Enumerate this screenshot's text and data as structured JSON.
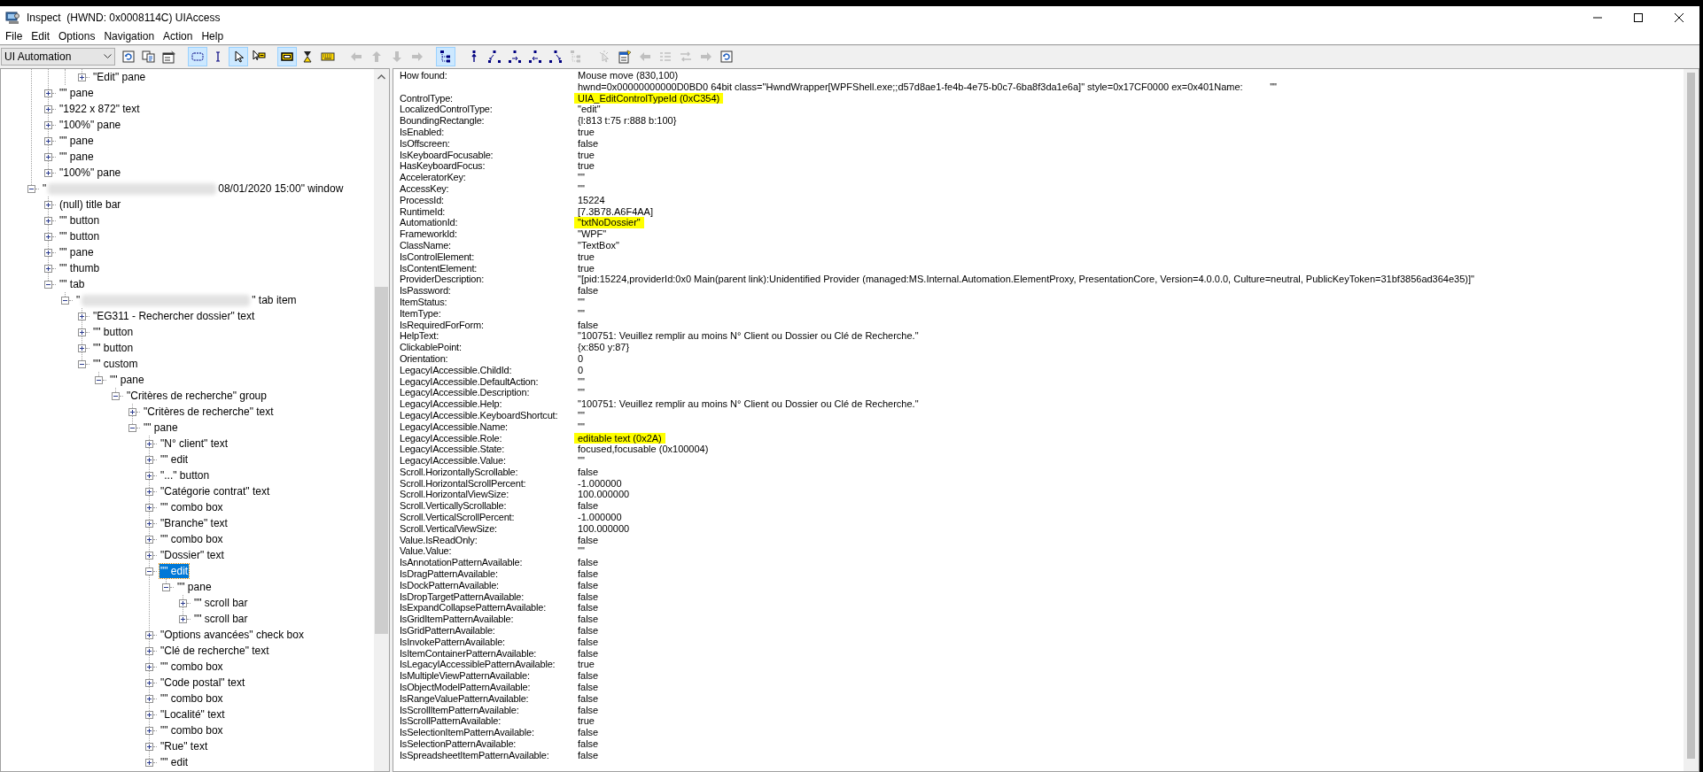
{
  "window": {
    "title": "Inspect  (HWND: 0x0008114C) UIAccess"
  },
  "menu": [
    "File",
    "Edit",
    "Options",
    "Navigation",
    "Action",
    "Help"
  ],
  "toolbar": {
    "mode_combo": {
      "value": "UI Automation"
    },
    "groups": [
      [
        {
          "kind": "refresh",
          "selected": false,
          "disabled": false
        },
        {
          "kind": "copy",
          "selected": false,
          "disabled": false
        },
        {
          "kind": "properties",
          "selected": false,
          "disabled": false
        }
      ],
      [
        {
          "kind": "rect",
          "selected": true,
          "disabled": false
        },
        {
          "kind": "caret",
          "selected": false,
          "disabled": false
        },
        {
          "kind": "pointer",
          "selected": true,
          "disabled": false
        },
        {
          "kind": "hover",
          "selected": false,
          "disabled": false
        }
      ],
      [
        {
          "kind": "highlight",
          "selected": true,
          "disabled": false
        },
        {
          "kind": "hourglass",
          "selected": false,
          "disabled": false
        },
        {
          "kind": "keyboard",
          "selected": false,
          "disabled": false
        }
      ],
      [
        {
          "kind": "left",
          "selected": false,
          "disabled": true
        },
        {
          "kind": "up",
          "selected": false,
          "disabled": true
        },
        {
          "kind": "down",
          "selected": false,
          "disabled": true
        },
        {
          "kind": "right",
          "selected": false,
          "disabled": true
        }
      ],
      [
        {
          "kind": "tree",
          "selected": true,
          "disabled": false
        }
      ],
      [
        {
          "kind": "parent",
          "selected": false,
          "disabled": false
        },
        {
          "kind": "first",
          "selected": false,
          "disabled": false
        },
        {
          "kind": "next",
          "selected": false,
          "disabled": false
        },
        {
          "kind": "prev",
          "selected": false,
          "disabled": false
        },
        {
          "kind": "last",
          "selected": false,
          "disabled": false
        },
        {
          "kind": "tree",
          "selected": false,
          "disabled": true
        }
      ],
      [
        {
          "kind": "click",
          "selected": false,
          "disabled": true
        },
        {
          "kind": "notepad",
          "selected": false,
          "disabled": false
        },
        {
          "kind": "left",
          "selected": false,
          "disabled": true
        },
        {
          "kind": "list",
          "selected": false,
          "disabled": true
        },
        {
          "kind": "swap",
          "selected": false,
          "disabled": true
        },
        {
          "kind": "right",
          "selected": false,
          "disabled": true
        },
        {
          "kind": "refresh",
          "selected": false,
          "disabled": false
        }
      ]
    ]
  },
  "tree": {
    "nodes": [
      {
        "children": [
          {
            "children": [
              {
                "children": [
                  {
                    "label": "\"Edit\" pane",
                    "expanded": false,
                    "selected": false
                  }
                ]
              }
            ]
          },
          {
            "label": "\"\" pane",
            "expanded": false,
            "selected": false
          },
          {
            "label": "\"1922 x 872\" text",
            "expanded": false,
            "selected": false
          },
          {
            "label": "\"100%\" pane",
            "expanded": false,
            "selected": false
          },
          {
            "label": "\"\" pane",
            "expanded": false,
            "selected": false
          },
          {
            "label": "\"\" pane",
            "expanded": false,
            "selected": false
          },
          {
            "label": "\"100%\" pane",
            "expanded": false,
            "selected": false
          }
        ]
      },
      {
        "prefix": "\"",
        "redacted": true,
        "label": "08/01/2020 15:00\" window",
        "expanded": true,
        "selected": false,
        "children": [
          {
            "label": "(null) title bar",
            "expanded": false,
            "selected": false
          },
          {
            "label": "\"\" button",
            "expanded": false,
            "selected": false
          },
          {
            "label": "\"\" button",
            "expanded": false,
            "selected": false
          },
          {
            "label": "\"\" pane",
            "expanded": false,
            "selected": false
          },
          {
            "label": "\"\" thumb",
            "expanded": false,
            "selected": false
          },
          {
            "label": "\"\" tab",
            "expanded": true,
            "selected": false,
            "children": [
              {
                "prefix": "\"",
                "redacted": true,
                "label": "\" tab item",
                "expanded": true,
                "selected": false,
                "children": [
                  {
                    "label": "\"EG311 - Rechercher dossier\" text",
                    "expanded": false,
                    "selected": false
                  },
                  {
                    "label": "\"\" button",
                    "expanded": false,
                    "selected": false
                  },
                  {
                    "label": "\"\" button",
                    "expanded": false,
                    "selected": false
                  },
                  {
                    "label": "\"\" custom",
                    "expanded": true,
                    "selected": false,
                    "children": [
                      {
                        "label": "\"\" pane",
                        "expanded": true,
                        "selected": false,
                        "children": [
                          {
                            "label": "\"Critères de recherche\" group",
                            "expanded": true,
                            "selected": false,
                            "children": [
                              {
                                "label": "\"Critères de recherche\" text",
                                "expanded": false,
                                "selected": false
                              },
                              {
                                "label": "\"\" pane",
                                "expanded": true,
                                "selected": false,
                                "children": [
                                  {
                                    "label": "\"N° client\" text",
                                    "expanded": false,
                                    "selected": false
                                  },
                                  {
                                    "label": "\"\" edit",
                                    "expanded": false,
                                    "selected": false
                                  },
                                  {
                                    "label": "\"...\" button",
                                    "expanded": false,
                                    "selected": false
                                  },
                                  {
                                    "label": "\"Catégorie contrat\" text",
                                    "expanded": false,
                                    "selected": false
                                  },
                                  {
                                    "label": "\"\" combo box",
                                    "expanded": false,
                                    "selected": false
                                  },
                                  {
                                    "label": "\"Branche\" text",
                                    "expanded": false,
                                    "selected": false
                                  },
                                  {
                                    "label": "\"\" combo box",
                                    "expanded": false,
                                    "selected": false
                                  },
                                  {
                                    "label": "\"Dossier\" text",
                                    "expanded": false,
                                    "selected": false
                                  },
                                  {
                                    "label": "\"\" edit",
                                    "expanded": true,
                                    "selected": true,
                                    "children": [
                                      {
                                        "label": "\"\" pane",
                                        "expanded": true,
                                        "selected": false,
                                        "children": [
                                          {
                                            "label": "\"\" scroll bar",
                                            "expanded": false,
                                            "selected": false
                                          },
                                          {
                                            "label": "\"\" scroll bar",
                                            "expanded": false,
                                            "selected": false
                                          }
                                        ]
                                      }
                                    ]
                                  },
                                  {
                                    "label": "\"Options avancées\" check box",
                                    "expanded": false,
                                    "selected": false
                                  },
                                  {
                                    "label": "\"Clé de recherche\" text",
                                    "expanded": false,
                                    "selected": false
                                  },
                                  {
                                    "label": "\"\" combo box",
                                    "expanded": false,
                                    "selected": false
                                  },
                                  {
                                    "label": "\"Code postal\" text",
                                    "expanded": false,
                                    "selected": false
                                  },
                                  {
                                    "label": "\"\" combo box",
                                    "expanded": false,
                                    "selected": false
                                  },
                                  {
                                    "label": "\"Localité\" text",
                                    "expanded": false,
                                    "selected": false
                                  },
                                  {
                                    "label": "\"\" combo box",
                                    "expanded": false,
                                    "selected": false
                                  },
                                  {
                                    "label": "\"Rue\" text",
                                    "expanded": false,
                                    "selected": false
                                  },
                                  {
                                    "label": "\"\" edit",
                                    "expanded": false,
                                    "selected": false
                                  }
                                ]
                              }
                            ]
                          }
                        ]
                      }
                    ]
                  }
                ]
              }
            ]
          }
        ]
      }
    ]
  },
  "properties": [
    {
      "name": "How found:",
      "value": "Mouse move (830,100)\nhwnd=0x00000000000D0BD0 64bit class=\"HwndWrapper[WPFShell.exe;;d57d8ae1-fe4b-4e75-b0c7-6ba8f3da1e6a]\" style=0x17CF0000 ex=0x401Name:          \"\"",
      "highlighted": false
    },
    {
      "name": "ControlType:",
      "value": "UIA_EditControlTypeId (0xC354)",
      "highlighted": true
    },
    {
      "name": "LocalizedControlType:",
      "value": "\"edit\"",
      "highlighted": false
    },
    {
      "name": "BoundingRectangle:",
      "value": "{l:813 t:75 r:888 b:100}",
      "highlighted": false
    },
    {
      "name": "IsEnabled:",
      "value": "true",
      "highlighted": false
    },
    {
      "name": "IsOffscreen:",
      "value": "false",
      "highlighted": false
    },
    {
      "name": "IsKeyboardFocusable:",
      "value": "true",
      "highlighted": false
    },
    {
      "name": "HasKeyboardFocus:",
      "value": "true",
      "highlighted": false
    },
    {
      "name": "AcceleratorKey:",
      "value": "\"\"",
      "highlighted": false
    },
    {
      "name": "AccessKey:",
      "value": "\"\"",
      "highlighted": false
    },
    {
      "name": "ProcessId:",
      "value": "15224",
      "highlighted": false
    },
    {
      "name": "RuntimeId:",
      "value": "[7.3B78.A6F4AA]",
      "highlighted": false
    },
    {
      "name": "AutomationId:",
      "value": "\"txtNoDossier\"",
      "highlighted": true
    },
    {
      "name": "FrameworkId:",
      "value": "\"WPF\"",
      "highlighted": false
    },
    {
      "name": "ClassName:",
      "value": "\"TextBox\"",
      "highlighted": false
    },
    {
      "name": "IsControlElement:",
      "value": "true",
      "highlighted": false
    },
    {
      "name": "IsContentElement:",
      "value": "true",
      "highlighted": false
    },
    {
      "name": "ProviderDescription:",
      "value": "\"[pid:15224,providerId:0x0 Main(parent link):Unidentified Provider (managed:MS.Internal.Automation.ElementProxy, PresentationCore, Version=4.0.0.0, Culture=neutral, PublicKeyToken=31bf3856ad364e35)]\"",
      "highlighted": false
    },
    {
      "name": "IsPassword:",
      "value": "false",
      "highlighted": false
    },
    {
      "name": "ItemStatus:",
      "value": "\"\"",
      "highlighted": false
    },
    {
      "name": "ItemType:",
      "value": "\"\"",
      "highlighted": false
    },
    {
      "name": "IsRequiredForForm:",
      "value": "false",
      "highlighted": false
    },
    {
      "name": "HelpText:",
      "value": "\"100751: Veuillez remplir au moins N° Client ou Dossier ou Clé de Recherche.\"",
      "highlighted": false
    },
    {
      "name": "ClickablePoint:",
      "value": "{x:850 y:87}",
      "highlighted": false
    },
    {
      "name": "Orientation:",
      "value": "0",
      "highlighted": false
    },
    {
      "name": "LegacyIAccessible.ChildId:",
      "value": "0",
      "highlighted": false
    },
    {
      "name": "LegacyIAccessible.DefaultAction:",
      "value": "\"\"",
      "highlighted": false
    },
    {
      "name": "LegacyIAccessible.Description:",
      "value": "\"\"",
      "highlighted": false
    },
    {
      "name": "LegacyIAccessible.Help:",
      "value": "\"100751: Veuillez remplir au moins N° Client ou Dossier ou Clé de Recherche.\"",
      "highlighted": false
    },
    {
      "name": "LegacyIAccessible.KeyboardShortcut:",
      "value": "\"\"",
      "highlighted": false
    },
    {
      "name": "LegacyIAccessible.Name:",
      "value": "\"\"",
      "highlighted": false
    },
    {
      "name": "LegacyIAccessible.Role:",
      "value": "editable text (0x2A)",
      "highlighted": true
    },
    {
      "name": "LegacyIAccessible.State:",
      "value": "focused,focusable (0x100004)",
      "highlighted": false
    },
    {
      "name": "LegacyIAccessible.Value:",
      "value": "\"\"",
      "highlighted": false
    },
    {
      "name": "Scroll.HorizontallyScrollable:",
      "value": "false",
      "highlighted": false
    },
    {
      "name": "Scroll.HorizontalScrollPercent:",
      "value": "-1.000000",
      "highlighted": false
    },
    {
      "name": "Scroll.HorizontalViewSize:",
      "value": "100.000000",
      "highlighted": false
    },
    {
      "name": "Scroll.VerticallyScrollable:",
      "value": "false",
      "highlighted": false
    },
    {
      "name": "Scroll.VerticalScrollPercent:",
      "value": "-1.000000",
      "highlighted": false
    },
    {
      "name": "Scroll.VerticalViewSize:",
      "value": "100.000000",
      "highlighted": false
    },
    {
      "name": "Value.IsReadOnly:",
      "value": "false",
      "highlighted": false
    },
    {
      "name": "Value.Value:",
      "value": "\"\"",
      "highlighted": false
    },
    {
      "name": "IsAnnotationPatternAvailable:",
      "value": "false",
      "highlighted": false
    },
    {
      "name": "IsDragPatternAvailable:",
      "value": "false",
      "highlighted": false
    },
    {
      "name": "IsDockPatternAvailable:",
      "value": "false",
      "highlighted": false
    },
    {
      "name": "IsDropTargetPatternAvailable:",
      "value": "false",
      "highlighted": false
    },
    {
      "name": "IsExpandCollapsePatternAvailable:",
      "value": "false",
      "highlighted": false
    },
    {
      "name": "IsGridItemPatternAvailable:",
      "value": "false",
      "highlighted": false
    },
    {
      "name": "IsGridPatternAvailable:",
      "value": "false",
      "highlighted": false
    },
    {
      "name": "IsInvokePatternAvailable:",
      "value": "false",
      "highlighted": false
    },
    {
      "name": "IsItemContainerPatternAvailable:",
      "value": "false",
      "highlighted": false
    },
    {
      "name": "IsLegacyIAccessiblePatternAvailable:",
      "value": "true",
      "highlighted": false
    },
    {
      "name": "IsMultipleViewPatternAvailable:",
      "value": "false",
      "highlighted": false
    },
    {
      "name": "IsObjectModelPatternAvailable:",
      "value": "false",
      "highlighted": false
    },
    {
      "name": "IsRangeValuePatternAvailable:",
      "value": "false",
      "highlighted": false
    },
    {
      "name": "IsScrollItemPatternAvailable:",
      "value": "false",
      "highlighted": false
    },
    {
      "name": "IsScrollPatternAvailable:",
      "value": "true",
      "highlighted": false
    },
    {
      "name": "IsSelectionItemPatternAvailable:",
      "value": "false",
      "highlighted": false
    },
    {
      "name": "IsSelectionPatternAvailable:",
      "value": "false",
      "highlighted": false
    },
    {
      "name": "IsSpreadsheetItemPatternAvailable:",
      "value": "false",
      "highlighted": false
    }
  ]
}
